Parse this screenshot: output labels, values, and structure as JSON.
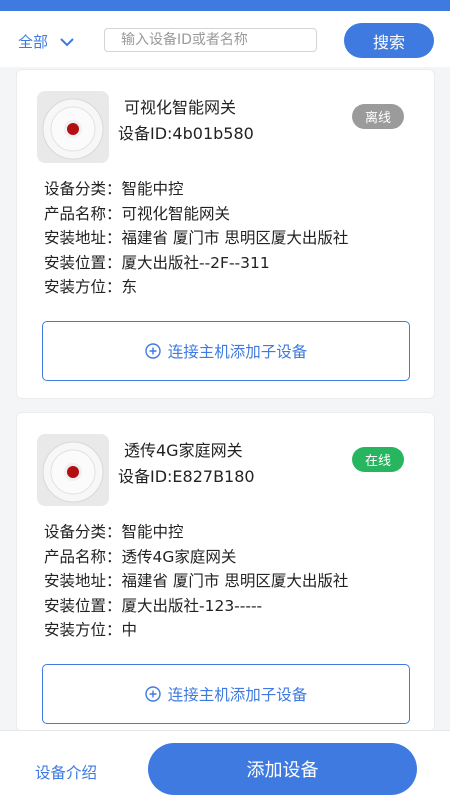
{
  "filter": {
    "category": "全部",
    "search_placeholder": "输入设备ID或者名称",
    "search_value": "",
    "search_button": "搜索"
  },
  "devices": [
    {
      "name": "可视化智能网关",
      "id": "设备ID:4b01b580",
      "status": "离线",
      "info": [
        "设备分类：智能中控",
        "产品名称：可视化智能网关",
        "安装地址：福建省 厦门市 思明区厦大出版社",
        "安装位置：厦大出版社--2F--311",
        "安装方位：东"
      ],
      "add_sub_label": "连接主机添加子设备"
    },
    {
      "name": "透传4G家庭网关",
      "id": "设备ID:E827B180",
      "status": "在线",
      "info": [
        "设备分类：智能中控",
        "产品名称：透传4G家庭网关",
        "安装地址：福建省 厦门市 思明区厦大出版社",
        "安装位置：厦大出版社-123-----",
        "安装方位：中"
      ],
      "add_sub_label": "连接主机添加子设备"
    }
  ],
  "bottom": {
    "intro_label": "设备介绍",
    "add_device_label": "添加设备"
  },
  "colors": {
    "accent": "#3f7ae0",
    "offline": "#9b9b9b",
    "online": "#27b65f"
  },
  "icons": [
    "chevron-down-icon",
    "device-image",
    "plus-circle-icon"
  ]
}
